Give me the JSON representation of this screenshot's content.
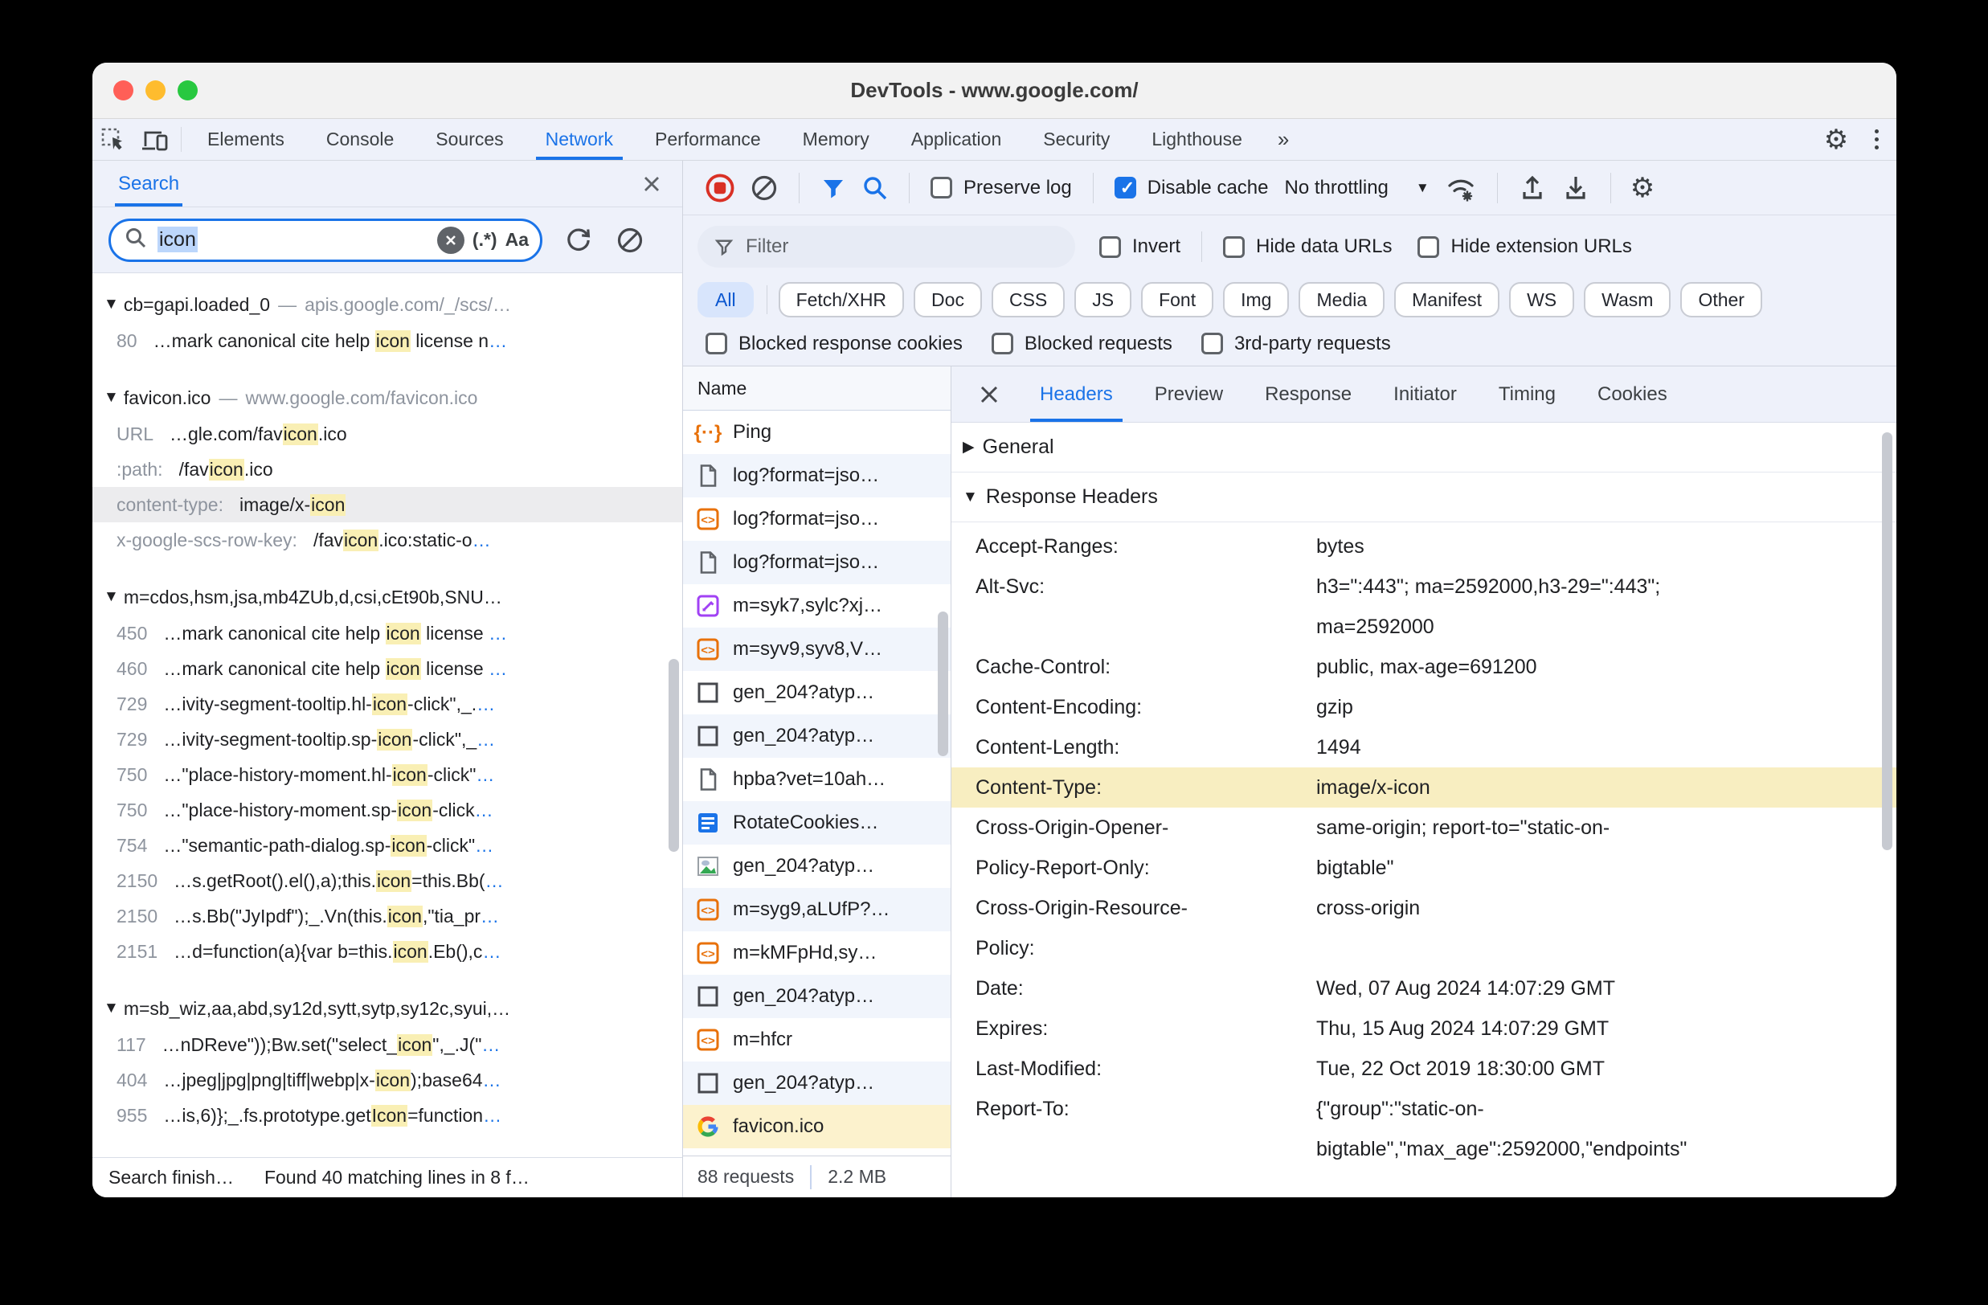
{
  "window": {
    "title": "DevTools - www.google.com/"
  },
  "main_tabs": {
    "items": [
      "Elements",
      "Console",
      "Sources",
      "Network",
      "Performance",
      "Memory",
      "Application",
      "Security",
      "Lighthouse"
    ],
    "active": "Network",
    "overflow": "»"
  },
  "search_panel": {
    "tab_label": "Search",
    "input": {
      "value": "icon",
      "regex_label": "(.*)",
      "case_label": "Aa"
    },
    "groups": [
      {
        "title": "cb=gapi.loaded_0",
        "url": "apis.google.com/_/scs/…",
        "matches": [
          {
            "line": "80",
            "pre": "…mark canonical cite help ",
            "match": "icon",
            "post": " license n",
            "tail": "…"
          }
        ]
      },
      {
        "title": "favicon.ico",
        "url": "www.google.com/favicon.ico",
        "matches": [
          {
            "line": "URL",
            "pre": "…gle.com/fav",
            "match": "icon",
            "post": ".ico",
            "tail": ""
          },
          {
            "line": ":path:",
            "pre": "/fav",
            "match": "icon",
            "post": ".ico",
            "tail": ""
          },
          {
            "line": "content-type:",
            "pre": "image/x-",
            "match": "icon",
            "post": "",
            "tail": "",
            "selected": true
          },
          {
            "line": "x-google-scs-row-key:",
            "pre": "/fav",
            "match": "icon",
            "post": ".ico:static-o",
            "tail": "…"
          }
        ]
      },
      {
        "title": "m=cdos,hsm,jsa,mb4ZUb,d,csi,cEt90b,SNU…",
        "url": "",
        "matches": [
          {
            "line": "450",
            "pre": "…mark canonical cite help ",
            "match": "icon",
            "post": " license ",
            "tail": "…"
          },
          {
            "line": "460",
            "pre": "…mark canonical cite help ",
            "match": "icon",
            "post": " license ",
            "tail": "…"
          },
          {
            "line": "729",
            "pre": "…ivity-segment-tooltip.hl-",
            "match": "icon",
            "post": "-click\",_.",
            "tail": "…"
          },
          {
            "line": "729",
            "pre": "…ivity-segment-tooltip.sp-",
            "match": "icon",
            "post": "-click\",_",
            "tail": "…"
          },
          {
            "line": "750",
            "pre": "…\"place-history-moment.hl-",
            "match": "icon",
            "post": "-click\"",
            "tail": "…"
          },
          {
            "line": "750",
            "pre": "…\"place-history-moment.sp-",
            "match": "icon",
            "post": "-click",
            "tail": "…"
          },
          {
            "line": "754",
            "pre": "…\"semantic-path-dialog.sp-",
            "match": "icon",
            "post": "-click\"",
            "tail": "…"
          },
          {
            "line": "2150",
            "pre": "…s.getRoot().el(),a);this.",
            "match": "icon",
            "post": "=this.Bb(",
            "tail": "…"
          },
          {
            "line": "2150",
            "pre": "…s.Bb(\"JyIpdf\");_.Vn(this.",
            "match": "icon",
            "post": ",\"tia_pr",
            "tail": "…"
          },
          {
            "line": "2151",
            "pre": "…d=function(a){var b=this.",
            "match": "icon",
            "post": ".Eb(),c",
            "tail": "…"
          }
        ]
      },
      {
        "title": "m=sb_wiz,aa,abd,sy12d,sytt,sytp,sy12c,syui,…",
        "url": "",
        "matches": [
          {
            "line": "117",
            "pre": "…nDReve\"));Bw.set(\"select_",
            "match": "icon",
            "post": "\",_.J(\"",
            "tail": "…"
          },
          {
            "line": "404",
            "pre": "…jpeg|jpg|png|tiff|webp|x-",
            "match": "icon",
            "post": ");base64",
            "tail": "…"
          },
          {
            "line": "955",
            "pre": "…is,6)};_.fs.prototype.get",
            "match": "Icon",
            "post": "=function",
            "tail": "…"
          }
        ]
      }
    ],
    "status": {
      "left": "Search finish…",
      "right": "Found 40 matching lines in 8 f…"
    }
  },
  "network": {
    "toolbar": {
      "preserve_log": "Preserve log",
      "disable_cache": "Disable cache",
      "throttling": "No throttling"
    },
    "filters": {
      "placeholder": "Filter",
      "invert": "Invert",
      "hide_data": "Hide data URLs",
      "hide_ext": "Hide extension URLs"
    },
    "chips": {
      "items": [
        "All",
        "Fetch/XHR",
        "Doc",
        "CSS",
        "JS",
        "Font",
        "Img",
        "Media",
        "Manifest",
        "WS",
        "Wasm",
        "Other"
      ],
      "active": "All"
    },
    "check_filters": [
      "Blocked response cookies",
      "Blocked requests",
      "3rd-party requests"
    ],
    "table": {
      "name_header": "Name",
      "rows": [
        {
          "icon": "ping",
          "label": "Ping"
        },
        {
          "icon": "doc",
          "label": "log?format=jso…"
        },
        {
          "icon": "script",
          "label": "log?format=jso…"
        },
        {
          "icon": "doc",
          "label": "log?format=jso…"
        },
        {
          "icon": "css",
          "label": "m=syk7,sylc?xj…"
        },
        {
          "icon": "script",
          "label": "m=syv9,syv8,V…"
        },
        {
          "icon": "blank",
          "label": "gen_204?atyp…"
        },
        {
          "icon": "blank",
          "label": "gen_204?atyp…"
        },
        {
          "icon": "doc",
          "label": "hpba?vet=10ah…"
        },
        {
          "icon": "html",
          "label": "RotateCookies…"
        },
        {
          "icon": "img",
          "label": "gen_204?atyp…"
        },
        {
          "icon": "script",
          "label": "m=syg9,aLUfP?…"
        },
        {
          "icon": "script",
          "label": "m=kMFpHd,sy…"
        },
        {
          "icon": "blank",
          "label": "gen_204?atyp…"
        },
        {
          "icon": "script",
          "label": "m=hfcr"
        },
        {
          "icon": "blank",
          "label": "gen_204?atyp…"
        },
        {
          "icon": "favicon",
          "label": "favicon.ico",
          "selected": true
        }
      ]
    },
    "status": {
      "requests": "88 requests",
      "size": "2.2 MB"
    }
  },
  "details": {
    "tabs": {
      "items": [
        "Headers",
        "Preview",
        "Response",
        "Initiator",
        "Timing",
        "Cookies"
      ],
      "active": "Headers"
    },
    "sections": {
      "general": "General",
      "response_headers": "Response Headers"
    },
    "response_headers": [
      {
        "key": "Accept-Ranges:",
        "value": "bytes"
      },
      {
        "key": "Alt-Svc:",
        "value": "h3=\":443\"; ma=2592000,h3-29=\":443\";\nma=2592000"
      },
      {
        "key": "Cache-Control:",
        "value": "public, max-age=691200"
      },
      {
        "key": "Content-Encoding:",
        "value": "gzip"
      },
      {
        "key": "Content-Length:",
        "value": "1494"
      },
      {
        "key": "Content-Type:",
        "value": "image/x-icon",
        "highlight": true
      },
      {
        "key": "Cross-Origin-Opener-\nPolicy-Report-Only:",
        "value": "same-origin; report-to=\"static-on-\nbigtable\""
      },
      {
        "key": "Cross-Origin-Resource-\nPolicy:",
        "value": "cross-origin"
      },
      {
        "key": "Date:",
        "value": "Wed, 07 Aug 2024 14:07:29 GMT"
      },
      {
        "key": "Expires:",
        "value": "Thu, 15 Aug 2024 14:07:29 GMT"
      },
      {
        "key": "Last-Modified:",
        "value": "Tue, 22 Oct 2019 18:30:00 GMT"
      },
      {
        "key": "Report-To:",
        "value": "{\"group\":\"static-on-\nbigtable\",\"max_age\":2592000,\"endpoints\""
      }
    ]
  },
  "colors": {
    "accent_blue": "#1a73e8",
    "chip_active_text": "#0b57d0",
    "match_highlight": "#f9efb4",
    "row_highlight": "#f8eec1",
    "selected_request": "#fcf2cd",
    "record_red": "#d93025",
    "script_orange": "#e8710a",
    "css_purple": "#a142f4"
  }
}
